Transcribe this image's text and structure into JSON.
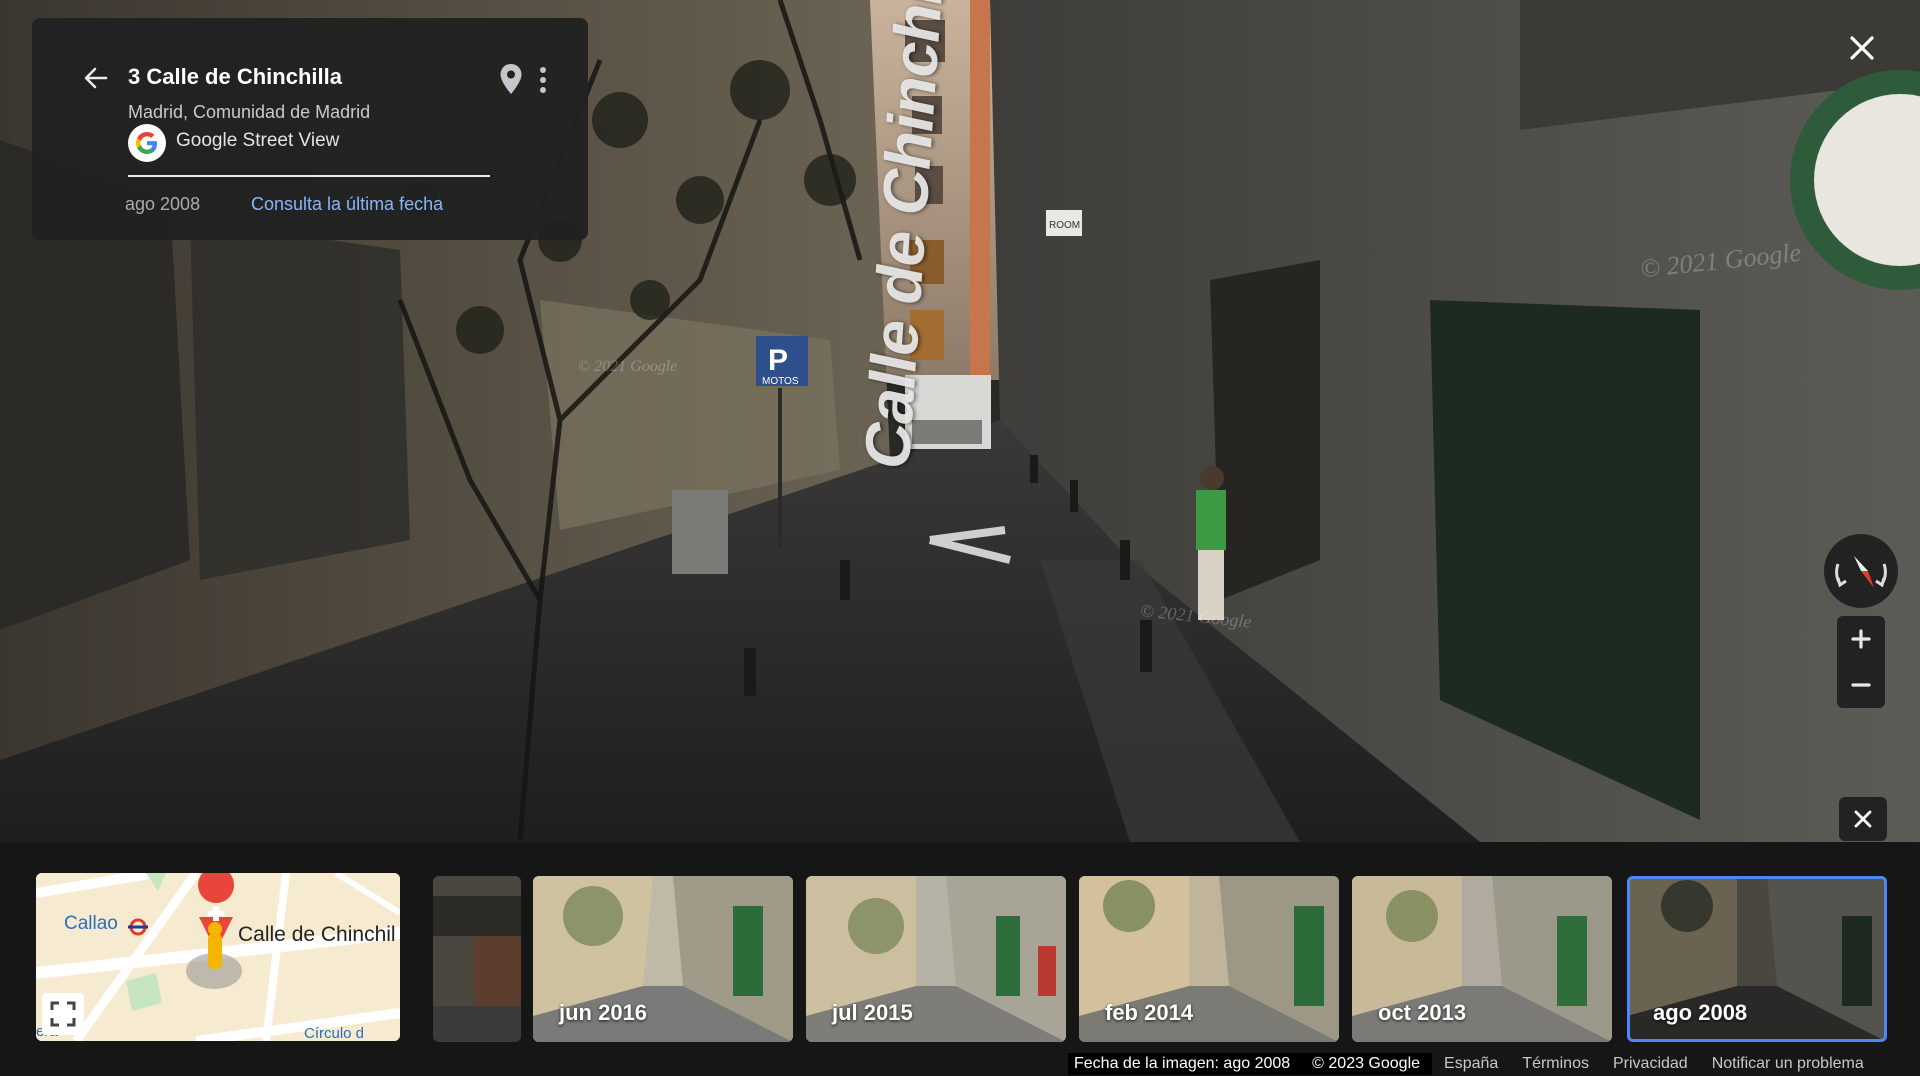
{
  "info_card": {
    "title": "3 Calle de Chinchilla",
    "subtitle": "Madrid, Comunidad de Madrid",
    "provider": "Google Street View",
    "current_date": "ago 2008",
    "latest_link": "Consulta la última fecha"
  },
  "scene": {
    "street_label": "Calle de Chinchilla",
    "watermark": "© 2021 Google",
    "sign_text": "MOTOS",
    "sign_letter": "P",
    "room_sign": "ROOM"
  },
  "minimap": {
    "station_label": "Callao",
    "street_label": "Calle de Chinchil",
    "bottom_label": "Círculo d",
    "left_label": "era"
  },
  "thumbnails": [
    {
      "label": ""
    },
    {
      "label": "jun 2016"
    },
    {
      "label": "jul 2015"
    },
    {
      "label": "feb 2014"
    },
    {
      "label": "oct 2013"
    },
    {
      "label": "ago 2008",
      "selected": true
    }
  ],
  "footer": {
    "image_date": "Fecha de la imagen: ago 2008",
    "copyright": "© 2023 Google",
    "country": "España",
    "terms": "Términos",
    "privacy": "Privacidad",
    "report": "Notificar un problema"
  },
  "colors": {
    "link": "#8ab4f8",
    "selected_outline": "#4b87f5",
    "panel": "#212121"
  },
  "icons": {
    "back": "arrow-left-icon",
    "pin": "map-pin-icon",
    "more": "more-vert-icon",
    "close": "close-icon",
    "compass": "compass-icon",
    "zoom_in": "plus-icon",
    "zoom_out": "minus-icon",
    "expand": "fullscreen-icon"
  }
}
